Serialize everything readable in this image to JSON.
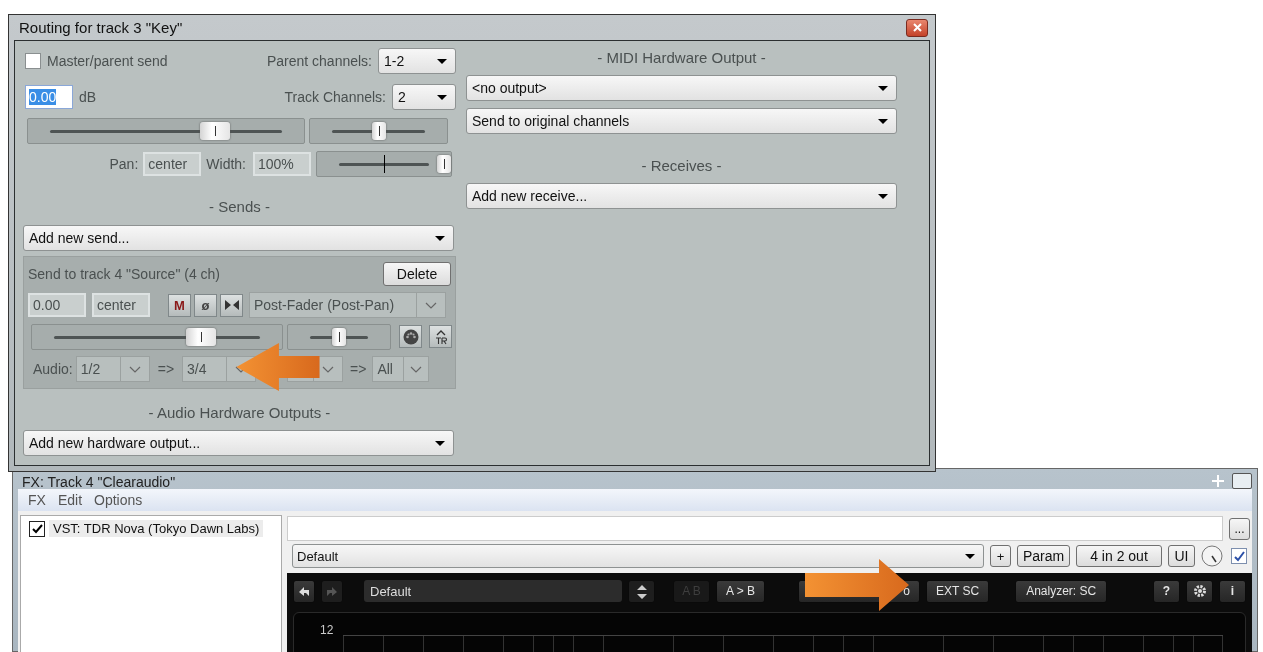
{
  "routing_window": {
    "title": "Routing for track 3 \"Key\"",
    "master_send": {
      "label": "Master/parent send",
      "checked": false
    },
    "parent_channels": {
      "label": "Parent channels:",
      "value": "1-2"
    },
    "volume": {
      "value": "0.00",
      "unit": "dB",
      "selected": true
    },
    "track_channels": {
      "label": "Track Channels:",
      "value": "2"
    },
    "volume_fader": {
      "level": 0.7
    },
    "pan_fader": {
      "level": 0.5
    },
    "pan": {
      "label": "Pan:",
      "value": "center"
    },
    "width": {
      "label": "Width:",
      "value": "100%"
    },
    "width_fader": {
      "level": 1.0
    },
    "sends": {
      "heading": "- Sends -",
      "add_select": "Add new send...",
      "items": [
        {
          "title": "Send to track 4 \"Source\" (4 ch)",
          "delete": "Delete",
          "volume": "0.00",
          "pan": "center",
          "mute": "M",
          "phase": "ø",
          "mode": "Post-Fader (Post-Pan)",
          "volume_fader": {
            "level": 0.7
          },
          "pan_fader": {
            "level": 0.5
          },
          "audio_label": "Audio:",
          "audio_source": "1/2",
          "arrow_1": "=>",
          "audio_dest": "3/4",
          "arrow_2": "=>",
          "midi_dest": "All",
          "annotation": {
            "kind": "leftarrow"
          }
        }
      ]
    },
    "audio_hardware": {
      "heading": "- Audio Hardware Outputs -",
      "add_select": "Add new hardware output..."
    },
    "midi_hardware": {
      "heading": "- MIDI Hardware Output -",
      "device": "<no output>",
      "channels": "Send to original channels"
    },
    "receives": {
      "heading": "- Receives -",
      "add_select": "Add new receive..."
    }
  },
  "fx_window": {
    "title": "FX: Track 4 \"Clearaudio\"",
    "menu": [
      "FX",
      "Edit",
      "Options"
    ],
    "fx_list": [
      {
        "label": "VST: TDR Nova (Tokyo Dawn Labs)",
        "checked": true,
        "selected": true
      }
    ],
    "more_button": "...",
    "preset": "Default",
    "add_button": "+",
    "param_button": "Param",
    "io_button": "4 in 2 out",
    "ui_button": "UI",
    "enabled": true,
    "plugin": {
      "preset": "Default",
      "ab_button": "A B",
      "copy_button": "A > B",
      "partial_button": "o",
      "ext_sc_button": "EXT SC",
      "analyzer_button": "Analyzer: SC",
      "help_button": "?",
      "info_button": "i",
      "graph_label": "12",
      "annotation": {
        "kind": "rightarrow"
      }
    }
  }
}
